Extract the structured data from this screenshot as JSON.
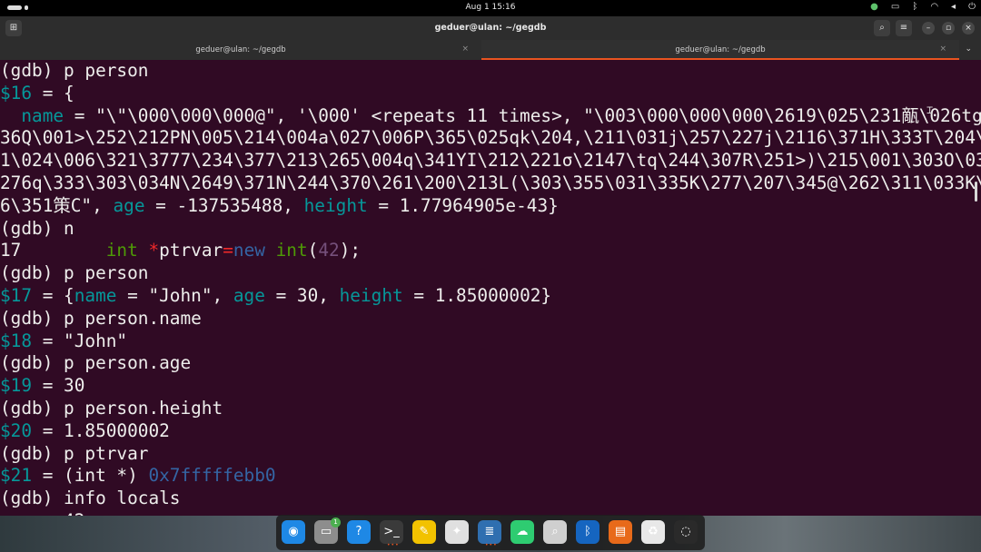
{
  "topbar": {
    "clock": "Aug 1  15:16",
    "tray": {
      "wechat_icon": "wechat-icon",
      "screen_icon": "screen-share-icon",
      "bluetooth_icon": "bluetooth-icon",
      "wifi_icon": "wifi-icon",
      "volume_icon": "volume-icon",
      "power_icon": "power-icon"
    }
  },
  "window": {
    "title": "geduer@ulan: ~/gegdb",
    "buttons": {
      "search": "⌕",
      "menu": "≡",
      "minimize": "–",
      "maximize": "▫",
      "close": "×"
    }
  },
  "tabs": [
    {
      "label": "geduer@ulan: ~/gegdb",
      "close": "×"
    },
    {
      "label": "geduer@ulan: ~/gegdb",
      "close": "×"
    }
  ],
  "terminal": {
    "lines": [
      [
        {
          "t": "(gdb) p person"
        }
      ],
      [
        {
          "t": "$16",
          "c": "teal"
        },
        {
          "t": " = {"
        }
      ],
      [
        {
          "t": "  "
        },
        {
          "t": "name",
          "c": "teal"
        },
        {
          "t": " = \"\\\"\\000\\000\\000@\", '\\000' <repeats 11 times>, \"\\003\\000\\000\\000\\2619\\025\\231甋\\026tg\\0"
        }
      ],
      [
        {
          "t": "36Q\\001>\\252\\212PN\\005\\214\\004a\\027\\006P\\365\\025qk\\204,\\211\\031j\\257\\227j\\2116\\371H\\333T\\204\\21"
        }
      ],
      [
        {
          "t": "1\\024\\006\\321\\3777\\234\\377\\213\\265\\004q\\341YI\\212\\221σ\\2147\\tq\\244\\307R\\251>)\\215\\001\\303O\\037\\"
        }
      ],
      [
        {
          "t": "276q\\333\\303\\034N\\2649\\371N\\244\\370\\261\\200\\213L(\\303\\355\\031\\335K\\277\\207\\345@\\262\\311\\033K\\35"
        }
      ],
      [
        {
          "t": "6\\351策C\", "
        },
        {
          "t": "age",
          "c": "teal"
        },
        {
          "t": " = -137535488, "
        },
        {
          "t": "height",
          "c": "teal"
        },
        {
          "t": " = 1.77964905e-43}"
        }
      ],
      [
        {
          "t": "(gdb) n"
        }
      ],
      [
        {
          "t": "17        "
        },
        {
          "t": "int",
          "c": "green"
        },
        {
          "t": " "
        },
        {
          "t": "*",
          "c": "red"
        },
        {
          "t": "ptrvar"
        },
        {
          "t": "=",
          "c": "red"
        },
        {
          "t": "new",
          "c": "blue"
        },
        {
          "t": " "
        },
        {
          "t": "int",
          "c": "green"
        },
        {
          "t": "("
        },
        {
          "t": "42",
          "c": "purple"
        },
        {
          "t": ");"
        }
      ],
      [
        {
          "t": "(gdb) p person"
        }
      ],
      [
        {
          "t": "$17",
          "c": "teal"
        },
        {
          "t": " = {"
        },
        {
          "t": "name",
          "c": "teal"
        },
        {
          "t": " = \"John\", "
        },
        {
          "t": "age",
          "c": "teal"
        },
        {
          "t": " = 30, "
        },
        {
          "t": "height",
          "c": "teal"
        },
        {
          "t": " = 1.85000002}"
        }
      ],
      [
        {
          "t": "(gdb) p person.name"
        }
      ],
      [
        {
          "t": "$18",
          "c": "teal"
        },
        {
          "t": " = \"John\""
        }
      ],
      [
        {
          "t": "(gdb) p person.age"
        }
      ],
      [
        {
          "t": "$19",
          "c": "teal"
        },
        {
          "t": " = 30"
        }
      ],
      [
        {
          "t": "(gdb) p person.height"
        }
      ],
      [
        {
          "t": "$20",
          "c": "teal"
        },
        {
          "t": " = 1.85000002"
        }
      ],
      [
        {
          "t": "(gdb) p ptrvar"
        }
      ],
      [
        {
          "t": "$21",
          "c": "teal"
        },
        {
          "t": " = (int *) "
        },
        {
          "t": "0x7fffffebb0",
          "c": "blue"
        }
      ],
      [
        {
          "t": "(gdb) info locals"
        }
      ],
      [
        {
          "t": "      42"
        }
      ]
    ]
  },
  "dock": [
    {
      "name": "chrome-icon",
      "glyph": "◉",
      "bg": "#1e88e5"
    },
    {
      "name": "files-icon",
      "glyph": "▭",
      "bg": "#8d8d8d",
      "badge": "1"
    },
    {
      "name": "help-icon",
      "glyph": "?",
      "bg": "#1e88e5"
    },
    {
      "name": "terminal-icon",
      "glyph": ">_",
      "bg": "#3a3a3a",
      "dots": "•••"
    },
    {
      "name": "text-editor-icon",
      "glyph": "✎",
      "bg": "#f2c200"
    },
    {
      "name": "inkscape-icon",
      "glyph": "✦",
      "bg": "#e0e0e0"
    },
    {
      "name": "writer-icon",
      "glyph": "≣",
      "bg": "#2f6fb0",
      "dots": "•••"
    },
    {
      "name": "wechat-icon",
      "glyph": "☁",
      "bg": "#2ecc71"
    },
    {
      "name": "image-viewer-icon",
      "glyph": "⌕",
      "bg": "#cfcfcf"
    },
    {
      "name": "bluetooth-icon",
      "glyph": "ᛒ",
      "bg": "#1565c0"
    },
    {
      "name": "impress-icon",
      "glyph": "▤",
      "bg": "#e86a1a"
    },
    {
      "name": "trash-icon",
      "glyph": "♻",
      "bg": "#e8e8e8"
    },
    {
      "name": "ubuntu-apps-icon",
      "glyph": "◌",
      "bg": "#2a2a2a"
    }
  ]
}
